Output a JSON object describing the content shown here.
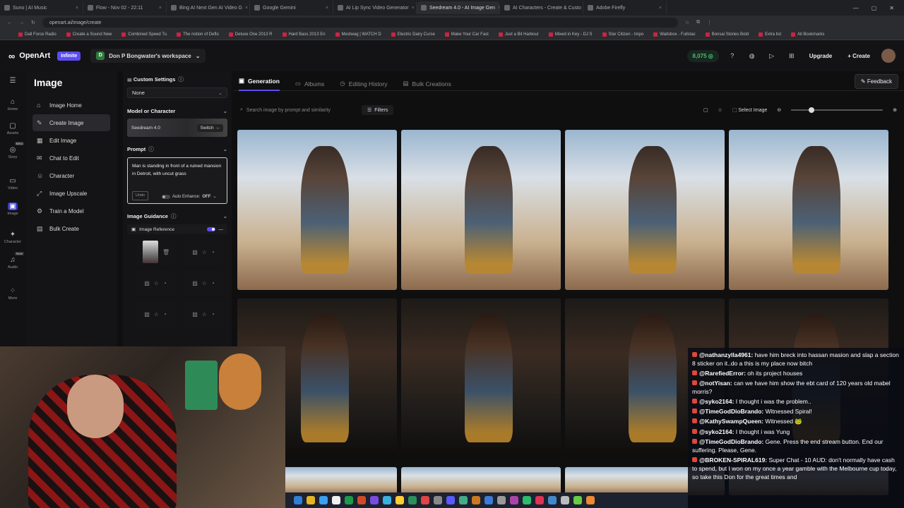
{
  "browser": {
    "tabs": [
      "Suno | AI Music",
      "Flow - Nov 02 - 22:11",
      "Bing AI Next Gen AI Video G",
      "Google Gemini",
      "AI Lip Sync Video Generator",
      "Seedream 4.0 - AI Image Gen",
      "AI Characters - Create & Custo",
      "Adobe Firefly"
    ],
    "active_tab": 5,
    "url": "openart.ai/image/create",
    "bookmarks": [
      "Dall Force Radio",
      "Create a Sound New",
      "Combined Speed Tu",
      "The notion of Deflo",
      "Deluxe One 2013 R",
      "Hard Bass 2013 En",
      "Mestwag | WATCH D",
      "Electric Dairy Curse",
      "Make Your Car Fast",
      "Just a Bit Harbour",
      "Mixed in Key - DJ S",
      "Star Citizen - Impo",
      "Waitsbox - Fullstac",
      "Bonsai Stories Bold",
      "Extra list",
      "All Bookmarks"
    ]
  },
  "header": {
    "brand": "OpenArt",
    "plan_badge": "Infinite",
    "workspace_initial": "D",
    "workspace_name": "Don P Bongwater's workspace",
    "credits": "8,075 ◎",
    "upgrade_label": "Upgrade",
    "create_label": "Create"
  },
  "rail": [
    {
      "icon": "home-icon",
      "glyph": "⌂",
      "label": "Home"
    },
    {
      "icon": "assets-icon",
      "glyph": "▢",
      "label": "Assets"
    },
    {
      "icon": "story-icon",
      "glyph": "◎",
      "label": "Story",
      "tag": "Beta"
    },
    {
      "icon": "video-icon",
      "glyph": "▭",
      "label": "Video"
    },
    {
      "icon": "image-icon",
      "glyph": "▣",
      "label": "Image"
    },
    {
      "icon": "character-icon",
      "glyph": "✦",
      "label": "Character"
    },
    {
      "icon": "audio-icon",
      "glyph": "♫",
      "label": "Audio",
      "tag": "New"
    },
    {
      "icon": "more-icon",
      "glyph": "⁘",
      "label": "More"
    }
  ],
  "nav": {
    "title": "Image",
    "items": [
      {
        "label": "Image Home",
        "glyph": "⌂"
      },
      {
        "label": "Create Image",
        "glyph": "✎"
      },
      {
        "label": "Edit Image",
        "glyph": "▦"
      },
      {
        "label": "Chat to Edit",
        "glyph": "✉"
      },
      {
        "label": "Character",
        "glyph": "☺"
      },
      {
        "label": "Image Upscale",
        "glyph": "⤢"
      },
      {
        "label": "Train a Model",
        "glyph": "⚙"
      },
      {
        "label": "Bulk Create",
        "glyph": "▤"
      }
    ],
    "active_index": 1
  },
  "settings": {
    "custom_settings_label": "Custom Settings",
    "custom_settings_value": "None",
    "model_label": "Model or Character",
    "model_name": "Seedream 4.0",
    "switch_label": "Switch",
    "prompt_label": "Prompt",
    "prompt_text": "Man is standing in front of a ruined mansion in Detroit, with uncut grass",
    "undo_label": "Undo",
    "auto_enhance_label": "Auto Enhance:",
    "auto_enhance_value": "OFF",
    "guidance_label": "Image Guidance",
    "image_reference_label": "Image Reference"
  },
  "main": {
    "tabs": [
      "Generation",
      "Albums",
      "Editing History",
      "Bulk Creations"
    ],
    "active_tab": 0,
    "feedback_label": "Feedback",
    "search_placeholder": "Search image by prompt and similarity",
    "filters_label": "Filters",
    "select_image_label": "Select Image",
    "zoom_level": 0.2
  },
  "chat": [
    {
      "user": "@nathanzylla4961:",
      "text": "have him breck into hassan masion and slap a section 8 sticker on it..do a this is my place now bitch"
    },
    {
      "user": "@RarefiedError:",
      "text": "oh its project houses"
    },
    {
      "user": "@notYisan:",
      "text": "can we have him show the ebt card of 120 years old mabel morris?"
    },
    {
      "user": "@syko2164:",
      "text": "I thought i was the problem.."
    },
    {
      "user": "@TimeGodDioBrando:",
      "text": "Witnessed Spiral!"
    },
    {
      "user": "@KathySwampQueen:",
      "text": "Witnessed 🐸"
    },
    {
      "user": "@syko2164:",
      "text": "I thought i was Yung"
    },
    {
      "user": "@TimeGodDioBrando:",
      "text": "Gene. Press the end stream button. End our suffering. Please, Gene."
    },
    {
      "user": "@BROKEN-SPIRAL619:",
      "text": "Super Chat - 10 AUD: don't normally have cash to spend, but I won on my once a year gamble with the Melbourne cup today, so take this Don for the great times and"
    }
  ],
  "colors": {
    "accent": "#5b4cf0",
    "credits": "#3ec46d",
    "chat_badge": "#e0463a"
  }
}
